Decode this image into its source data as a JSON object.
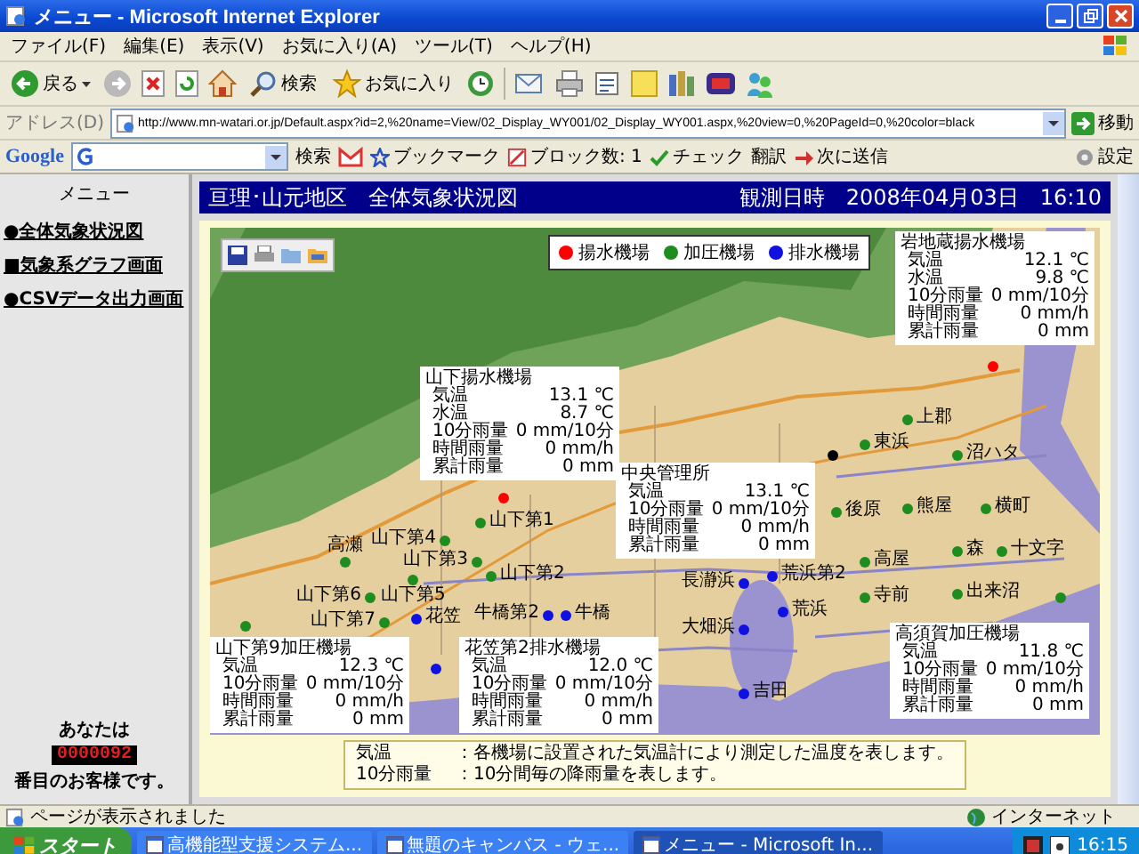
{
  "window": {
    "title": "メニュー - Microsoft Internet Explorer"
  },
  "menu_bar": [
    "ファイル(F)",
    "編集(E)",
    "表示(V)",
    "お気に入り(A)",
    "ツール(T)",
    "ヘルプ(H)"
  ],
  "toolbar": {
    "back": "戻る",
    "search": "検索",
    "favorites": "お気に入り"
  },
  "address_bar": {
    "label": "アドレス(D)",
    "url": "http://www.mn-watari.or.jp/Default.aspx?id=2,%20name=View/02_Display_WY001/02_Display_WY001.aspx,%20view=0,%20PageId=0,%20color=black",
    "go": "移動"
  },
  "google_bar": {
    "logo": "Google",
    "search": "検索",
    "bookmarks": "ブックマーク",
    "blocked": "ブロック数: 1",
    "check": "チェック",
    "translate": "翻訳",
    "send": "次に送信",
    "settings": "設定"
  },
  "sidebar": {
    "title": "メニュー",
    "items": [
      {
        "label": "●全体気象状況図"
      },
      {
        "label": "■気象系グラフ画面"
      },
      {
        "label": "●CSVデータ出力画面"
      }
    ],
    "counter": {
      "prefix": "あなたは",
      "count": "0000092",
      "suffix": "番目のお客様です。"
    }
  },
  "header": {
    "title": "亘理･山元地区　全体気象状況図",
    "observed": "観測日時　2008年04月03日　16:10"
  },
  "map": {
    "popups": [
      {
        "name": "岩地蔵揚水機場",
        "rows": [
          {
            "label": "気温",
            "value": "12.1 ℃"
          },
          {
            "label": "水温",
            "value": "9.8 ℃"
          },
          {
            "label": "10分雨量",
            "value": "0 mm/10分"
          },
          {
            "label": "時間雨量",
            "value": "0 mm/h"
          },
          {
            "label": "累計雨量",
            "value": "0 mm"
          }
        ]
      },
      {
        "name": "山下揚水機場",
        "rows": [
          {
            "label": "気温",
            "value": "13.1 ℃"
          },
          {
            "label": "水温",
            "value": "8.7 ℃"
          },
          {
            "label": "10分雨量",
            "value": "0 mm/10分"
          },
          {
            "label": "時間雨量",
            "value": "0 mm/h"
          },
          {
            "label": "累計雨量",
            "value": "0 mm"
          }
        ]
      },
      {
        "name": "中央管理所",
        "rows": [
          {
            "label": "気温",
            "value": "13.1 ℃"
          },
          {
            "label": "10分雨量",
            "value": "0 mm/10分"
          },
          {
            "label": "時間雨量",
            "value": "0 mm/h"
          },
          {
            "label": "累計雨量",
            "value": "0 mm"
          }
        ]
      },
      {
        "name": "高須賀加圧機場",
        "rows": [
          {
            "label": "気温",
            "value": "11.8 ℃"
          },
          {
            "label": "10分雨量",
            "value": "0 mm/10分"
          },
          {
            "label": "時間雨量",
            "value": "0 mm/h"
          },
          {
            "label": "累計雨量",
            "value": "0 mm"
          }
        ]
      },
      {
        "name": "山下第9加圧機場",
        "rows": [
          {
            "label": "気温",
            "value": "12.3 ℃"
          },
          {
            "label": "10分雨量",
            "value": "0 mm/10分"
          },
          {
            "label": "時間雨量",
            "value": "0 mm/h"
          },
          {
            "label": "累計雨量",
            "value": "0 mm"
          }
        ]
      },
      {
        "name": "花笠第2排水機場",
        "rows": [
          {
            "label": "気温",
            "value": "12.0 ℃"
          },
          {
            "label": "10分雨量",
            "value": "0 mm/10分"
          },
          {
            "label": "時間雨量",
            "value": "0 mm/h"
          },
          {
            "label": "累計雨量",
            "value": "0 mm"
          }
        ]
      }
    ],
    "stations": [
      {
        "label": "上郡",
        "color": "#1e8c1e"
      },
      {
        "label": "東浜",
        "color": "#1e8c1e"
      },
      {
        "label": "沼ハタ",
        "color": "#1e8c1e"
      },
      {
        "color": "#000000"
      },
      {
        "label": "後原",
        "color": "#1e8c1e"
      },
      {
        "label": "熊屋",
        "color": "#1e8c1e"
      },
      {
        "label": "横町",
        "color": "#1e8c1e"
      },
      {
        "label": "森",
        "color": "#1e8c1e"
      },
      {
        "label": "十文字",
        "color": "#1e8c1e"
      },
      {
        "label": "高屋",
        "color": "#1e8c1e"
      },
      {
        "label": "寺前",
        "color": "#1e8c1e"
      },
      {
        "label": "出来沼",
        "color": "#1e8c1e"
      },
      {
        "color": "#1e8c1e"
      },
      {
        "label": "高瀬",
        "color": "#1e8c1e"
      },
      {
        "label": "山下第4",
        "color": "#1e8c1e"
      },
      {
        "label": "山下第1",
        "color": "#1e8c1e"
      },
      {
        "label": "山下第3",
        "color": "#1e8c1e"
      },
      {
        "label": "山下第2",
        "color": "#1e8c1e"
      },
      {
        "label": "山下第6",
        "color": "#1e8c1e"
      },
      {
        "label": "山下第5",
        "color": "#1e8c1e"
      },
      {
        "label": "山下第7",
        "color": "#1e8c1e"
      },
      {
        "color": "#1e8c1e"
      },
      {
        "label": "花笠",
        "color": "#1010e0"
      },
      {
        "color": "#1010e0"
      },
      {
        "label": "牛橋第2",
        "color": "#1010e0"
      },
      {
        "label": "牛橋",
        "color": "#1010e0"
      },
      {
        "label": "長瀞浜",
        "color": "#1010e0"
      },
      {
        "label": "荒浜第2",
        "color": "#1010e0"
      },
      {
        "label": "荒浜",
        "color": "#1010e0"
      },
      {
        "label": "大畑浜",
        "color": "#1010e0"
      },
      {
        "label": "吉田",
        "color": "#1010e0"
      },
      {
        "color": "#ff0000"
      },
      {
        "color": "#ff0000"
      }
    ],
    "legend": [
      {
        "label": "揚水機場",
        "color": "#ff0000"
      },
      {
        "label": "加圧機場",
        "color": "#1e8c1e"
      },
      {
        "label": "排水機場",
        "color": "#1010e0"
      }
    ]
  },
  "notes": [
    {
      "term": "気温",
      "text": "：各機場に設置された気温計により測定した温度を表します。"
    },
    {
      "term": "10分雨量",
      "text": "：10分間毎の降雨量を表します。"
    }
  ],
  "status_bar": {
    "message": "ページが表示されました",
    "zone": "インターネット"
  },
  "taskbar": {
    "start": "スタート",
    "tasks": [
      {
        "label": "高機能型支援システム...",
        "selected": false
      },
      {
        "label": "無題のキャンバス - ウェ...",
        "selected": false
      },
      {
        "label": "メニュー - Microsoft In...",
        "selected": true
      }
    ],
    "clock": "16:15"
  }
}
